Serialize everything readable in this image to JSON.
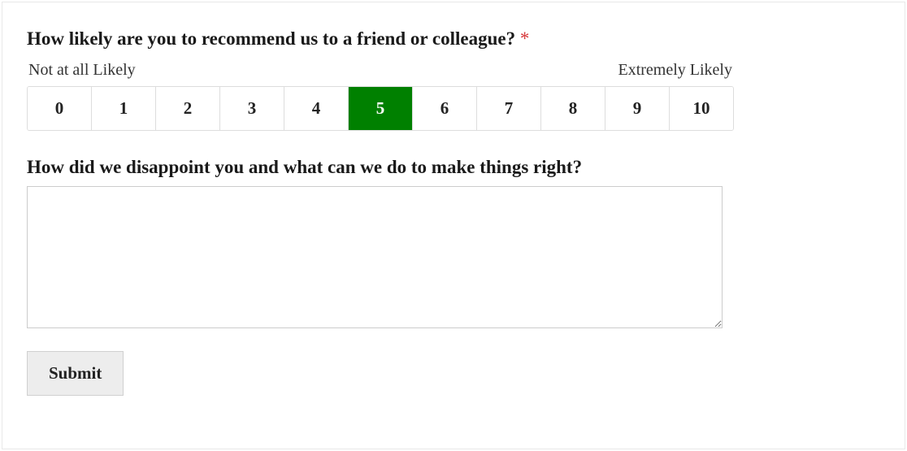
{
  "question1": {
    "label": "How likely are you to recommend us to a friend or colleague?",
    "required_mark": "*",
    "low_label": "Not at all Likely",
    "high_label": "Extremely Likely",
    "options": [
      "0",
      "1",
      "2",
      "3",
      "4",
      "5",
      "6",
      "7",
      "8",
      "9",
      "10"
    ],
    "selected": "5"
  },
  "question2": {
    "label": "How did we disappoint you and what can we do to make things right?",
    "value": ""
  },
  "submit": {
    "label": "Submit"
  }
}
